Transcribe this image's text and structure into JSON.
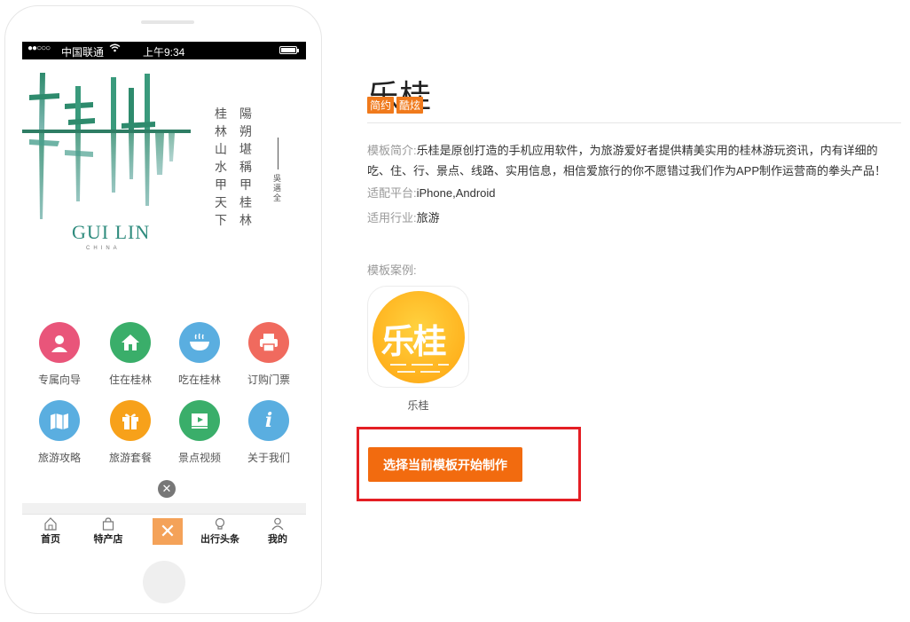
{
  "phone": {
    "status_bar": {
      "signal": "●●○○○",
      "carrier": "中国联通",
      "time": "上午9:34"
    },
    "banner": {
      "logo_text": "GUI LIN",
      "logo_sub": "CHINA",
      "poem_columns": [
        "陽朔堪稱甲桂林",
        "桂林山水甲天下"
      ],
      "author": "吳邁全"
    },
    "menu": [
      {
        "label": "专属向导",
        "color": "#e9557a",
        "icon": "person-icon"
      },
      {
        "label": "住在桂林",
        "color": "#3aae6a",
        "icon": "house-icon"
      },
      {
        "label": "吃在桂林",
        "color": "#5aaee0",
        "icon": "bowl-icon"
      },
      {
        "label": "订购门票",
        "color": "#f06a5e",
        "icon": "ticket-printer-icon"
      },
      {
        "label": "旅游攻略",
        "color": "#5aaee0",
        "icon": "map-book-icon"
      },
      {
        "label": "旅游套餐",
        "color": "#f7a11a",
        "icon": "gift-icon"
      },
      {
        "label": "景点视频",
        "color": "#3aae6a",
        "icon": "video-icon"
      },
      {
        "label": "关于我们",
        "color": "#5aaee0",
        "icon": "info-icon"
      }
    ],
    "tabs": [
      {
        "label": "首页",
        "icon": "home-icon"
      },
      {
        "label": "特产店",
        "icon": "bag-icon"
      },
      {
        "label": "出行头条",
        "icon": "bulb-icon"
      },
      {
        "label": "我的",
        "icon": "user-icon"
      }
    ]
  },
  "detail": {
    "title": "乐桂",
    "tags": [
      "简约",
      "酷炫"
    ],
    "desc_key": "模板简介:",
    "desc_value": "乐桂是原创打造的手机应用软件，为旅游爱好者提供精美实用的桂林游玩资讯，内有详细的吃、住、行、景点、线路、实用信息，相信爱旅行的你不愿错过我们作为APP制作运营商的拳头产品！",
    "platform_key": "适配平台:",
    "platform_value": "iPhone,Android",
    "industry_key": "适用行业:",
    "industry_value": "旅游",
    "cases_label": "模板案例:",
    "case_icon_text": "乐桂",
    "case_name": "乐桂",
    "start_button": "选择当前模板开始制作"
  }
}
